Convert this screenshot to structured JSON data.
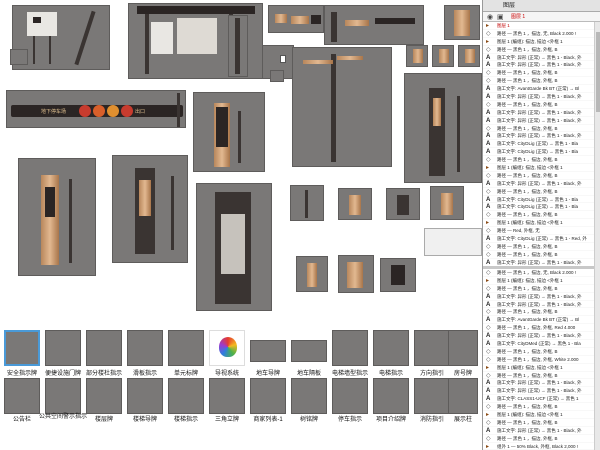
{
  "layers_panel": {
    "title": "图层",
    "subtitle": "图层 1",
    "tabs": [
      "图层",
      "图层 1"
    ]
  },
  "canvas": {
    "sign_strip_labels": [
      "地下停车场",
      "出口"
    ],
    "thumbnails": [
      {
        "label": "安全指示牌",
        "selected": true
      },
      {
        "label": "便捷设施门牌",
        "selected": false
      },
      {
        "label": "部分楼杜指示",
        "selected": false
      },
      {
        "label": "滑板指示",
        "selected": false
      },
      {
        "label": "单元标牌",
        "selected": false
      },
      {
        "label": "导视系统",
        "selected": false
      },
      {
        "label": "地车导牌",
        "selected": false
      },
      {
        "label": "地车隔板",
        "selected": false
      },
      {
        "label": "电梯墙型指示",
        "selected": false
      },
      {
        "label": "电梯指示",
        "selected": false
      },
      {
        "label": "方向指引",
        "selected": false
      },
      {
        "label": "房号牌",
        "selected": false
      },
      {
        "label": "公告栏",
        "selected": false
      },
      {
        "label": "公共空间警示指示",
        "selected": false
      },
      {
        "label": "楼层牌",
        "selected": false
      },
      {
        "label": "楼梯导牌",
        "selected": false
      },
      {
        "label": "楼梯指示",
        "selected": false
      },
      {
        "label": "三角立牌",
        "selected": false
      },
      {
        "label": "商家列表-1",
        "selected": false
      },
      {
        "label": "树铭牌",
        "selected": false
      },
      {
        "label": "停车指示",
        "selected": false
      },
      {
        "label": "项目介绍牌",
        "selected": false
      },
      {
        "label": "消防指引",
        "selected": false
      },
      {
        "label": "展示柱",
        "selected": false
      }
    ]
  },
  "layers": [
    {
      "kind": "group",
      "text": "图层 1",
      "red": true
    },
    {
      "kind": "path",
      "text": "路径 — 黑色 1 ，描边, 无, Black 2.000 !",
      "red": false
    },
    {
      "kind": "group",
      "text": "图层 1 (编组): 描边, 描边 <外框 1",
      "red": false
    },
    {
      "kind": "path",
      "text": "路径 — 黑色 1 ，描边, 外框, B",
      "red": false
    },
    {
      "kind": "A",
      "text": "施工文字: 异形 (正常) → 黑色 1 - Black, 外",
      "red": false
    },
    {
      "kind": "A",
      "text": "施工文字: 异形 (正常) → 黑色 1 - Black, 外",
      "red": false
    },
    {
      "kind": "path",
      "text": "路径 — 黑色 1 ，描边, 外框, B",
      "red": false
    },
    {
      "kind": "path",
      "text": "路径 — 黑色 1 ，描边, 外框, B",
      "red": false
    },
    {
      "kind": "A",
      "text": "施工文字: AvantGarde Bk BT (正常) → Bl",
      "red": false
    },
    {
      "kind": "A",
      "text": "施工文字: 异形 (正常) → 黑色 1 - Black, 外",
      "red": false
    },
    {
      "kind": "path",
      "text": "路径 — 黑色 1 ，描边, 外框, B",
      "red": false
    },
    {
      "kind": "A",
      "text": "施工文字: 异形 (正常) → 黑色 1 - Black, 外",
      "red": false
    },
    {
      "kind": "A",
      "text": "施工文字: 异形 (正常) → 黑色 1 - Black, 外",
      "red": false
    },
    {
      "kind": "path",
      "text": "路径 — 黑色 1 ，描边, 外框, B",
      "red": false
    },
    {
      "kind": "A",
      "text": "施工文字: 异形 (正常) → 黑色 1 - Black, 外",
      "red": false
    },
    {
      "kind": "A",
      "text": "施工文字: CityDLig (正常) → 黑色 1 - Bla",
      "red": false
    },
    {
      "kind": "A",
      "text": "施工文字: CityDLig (正常) → 黑色 1 - Bla",
      "red": false
    },
    {
      "kind": "path",
      "text": "路径 — 黑色 1 ，描边, 外框, B",
      "red": false
    },
    {
      "kind": "group",
      "text": "图层 1 (编组): 描边, 描边 <外框 1",
      "red": false
    },
    {
      "kind": "path",
      "text": "路径 — 黑色 1 ，描边, 外框, B",
      "red": false
    },
    {
      "kind": "A",
      "text": "施工文字: 异形 (正常) → 黑色 1 - Black, 外",
      "red": false
    },
    {
      "kind": "path",
      "text": "路径 — 黑色 1 ，描边, 外框, B",
      "red": false
    },
    {
      "kind": "A",
      "text": "施工文字: CityDLig (正常) → 黑色 1 - Bla",
      "red": false
    },
    {
      "kind": "A",
      "text": "施工文字: CityDLig (正常) → 黑色 1 - Bla",
      "red": false
    },
    {
      "kind": "path",
      "text": "路径 — 黑色 1 ，描边, 外框, B",
      "red": false
    },
    {
      "kind": "group",
      "text": "图层 1 (编组): 描边, 描边 <外框 1",
      "red": false
    },
    {
      "kind": "path",
      "text": "路径 — Red, 外框, 无",
      "red": false
    },
    {
      "kind": "A",
      "text": "施工文字: CityDLig (正常) → 黑色 1 - Red, 外",
      "red": false
    },
    {
      "kind": "path",
      "text": "路径 — 黑色 1 ，描边, 外框, B",
      "red": false
    },
    {
      "kind": "path",
      "text": "路径 — 黑色 1 ，描边, 外框, B",
      "red": false
    },
    {
      "kind": "A",
      "text": "施工文字: 异形 (正常) → 黑色 1 - Black, 外",
      "red": false
    },
    {
      "kind": "group",
      "text": "图层 1 (编组): 描边, 描边 <外框 1",
      "red": false
    },
    {
      "kind": "group",
      "text": "组外 1 — 50% Black, 外框, Black 2,000 !",
      "red": false
    },
    {
      "kind": "A",
      "text": "施工文字: AvantGarde Bk BT (正常) → Bl",
      "red": false
    },
    {
      "kind": "path",
      "text": "路径 — 黑色 1 ，描边, 外框, B",
      "red": false
    }
  ],
  "layers_lower": [
    {
      "kind": "path",
      "text": "路径 — 黑色 1 ，描边, 无, Black 2.000 !",
      "red": false
    },
    {
      "kind": "group",
      "text": "图层 1 (编组): 描边, 描边 <外框 1",
      "red": false
    },
    {
      "kind": "path",
      "text": "路径 — 黑色 1 ，描边, 外框, B",
      "red": false
    },
    {
      "kind": "A",
      "text": "施工文字: 异形 (正常) → 黑色 1 - Black, 外",
      "red": false
    },
    {
      "kind": "A",
      "text": "施工文字: 异形 (正常) → 黑色 1 - Black, 外",
      "red": false
    },
    {
      "kind": "path",
      "text": "路径 — 黑色 1 ，描边, 外框, B",
      "red": false
    },
    {
      "kind": "A",
      "text": "施工文字: AvantGarde Bk BT (正常) → Bl",
      "red": false
    },
    {
      "kind": "path",
      "text": "路径 — 黑色 1 ，描边, 外框, Red 4.000",
      "red": false
    },
    {
      "kind": "A",
      "text": "施工文字: 异形 (正常) → 黑色 1 - Black, 外",
      "red": false
    },
    {
      "kind": "A",
      "text": "施工文字: CityDMed (正常) → 黑色 1 - Bla",
      "red": false
    },
    {
      "kind": "path",
      "text": "路径 — 黑色 1 ，描边, 外框, B",
      "red": false
    },
    {
      "kind": "path",
      "text": "路径 — 黑色 1 ，描边, 外框, White 2.000",
      "red": false
    },
    {
      "kind": "group",
      "text": "图层 1 (编组): 描边, 描边 <外框 1",
      "red": false
    },
    {
      "kind": "path",
      "text": "路径 — 黑色 1 ，描边, 外框, B",
      "red": false
    },
    {
      "kind": "A",
      "text": "施工文字: 异形 (正常) → 黑色 1 - Black, 外",
      "red": false
    },
    {
      "kind": "A",
      "text": "施工文字: 异形 (正常) → 黑色 1 - Black, 外",
      "red": false
    },
    {
      "kind": "A",
      "text": "施工文字: CLASS1-UCF (正常) → 黑色 1",
      "red": false
    },
    {
      "kind": "path",
      "text": "路径 — 黑色 1 ，描边, 外框, B",
      "red": false
    },
    {
      "kind": "group",
      "text": "图层 1 (编组): 描边, 描边 <外框 1",
      "red": false
    },
    {
      "kind": "path",
      "text": "路径 — 黑色 1 ，描边, 外框, B",
      "red": false
    },
    {
      "kind": "A",
      "text": "施工文字: 异形 (正常) → 黑色 1 - Black, 外",
      "red": false
    },
    {
      "kind": "path",
      "text": "路径 — 黑色 1 ，描边, 外框, B",
      "red": false
    },
    {
      "kind": "group",
      "text": "组外 1 — 50% Black, 外框, Black 2,000 !",
      "red": false
    },
    {
      "kind": "A",
      "text": "施工文字: AvantGarde Bk BT (正常) → Bl",
      "red": false
    },
    {
      "kind": "path",
      "text": "路径 — 黑色 1 ，描边, 外框, B",
      "red": false
    }
  ]
}
